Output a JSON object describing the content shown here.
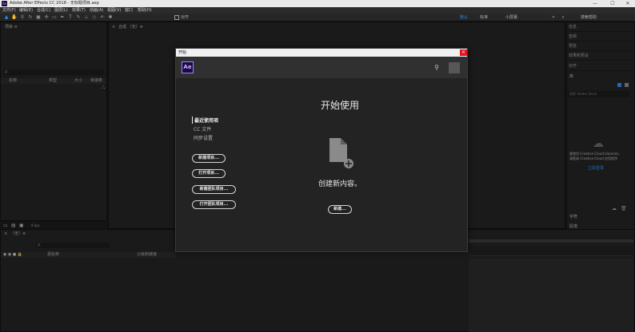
{
  "window": {
    "app_icon": "Ae",
    "title": "Adobe After Effects CC 2018 - 无标题项目.aep",
    "minimize": "—",
    "maximize": "☐",
    "close": "✕"
  },
  "menu": [
    "文件(F)",
    "编辑(E)",
    "合成(C)",
    "图层(L)",
    "效果(T)",
    "动画(A)",
    "视图(V)",
    "窗口",
    "帮助(H)"
  ],
  "toolbar": {
    "snap_label": "对齐",
    "default_label": "默认",
    "standard_label": "标准",
    "small_screen_label": "小屏幕",
    "search_help": "搜索帮助"
  },
  "project_panel": {
    "tab": "项目 ≡",
    "search_placeholder": "ρ.",
    "col_name": "名称",
    "col_type": "类型",
    "col_size": "大小",
    "col_rate": "帧速率",
    "bpc": "8 bpc"
  },
  "comp_panel": {
    "tab": "合成 （无）≡"
  },
  "timeline": {
    "tab": "（无）≡",
    "search_placeholder": "ρ.",
    "col_source": "源名称",
    "col_parent": "父级和链接"
  },
  "right_panel": {
    "items": [
      "信息",
      "音频",
      "预览",
      "效果和预设",
      "对齐"
    ],
    "library_tab": "库",
    "library_search": "搜索 Adobe Stock",
    "library_msg1": "要使用 Creative Cloud Libraries，",
    "library_msg2": "请登录 Creative Cloud 应用程序",
    "library_link": "立即登录",
    "char_tab": "字符",
    "para_tab": "段落"
  },
  "dialog": {
    "title": "开始",
    "close_icon": "×",
    "logo": "Ae",
    "heading": "开始使用",
    "nav": [
      "最近使用项",
      "CC 文件",
      "同步设置"
    ],
    "buttons": [
      "新建项目...",
      "打开项目...",
      "新建团队项目...",
      "打开团队项目..."
    ],
    "create_text": "创建新内容。",
    "create_button": "新建..."
  }
}
